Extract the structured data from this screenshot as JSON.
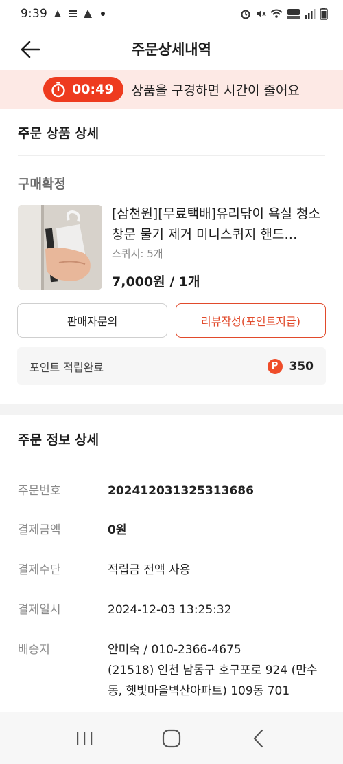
{
  "status_bar": {
    "time": "9:39"
  },
  "header": {
    "title": "주문상세내역"
  },
  "banner": {
    "timer": "00:49",
    "message": "상품을 구경하면 시간이 줄어요"
  },
  "order_items": {
    "section_title": "주문 상품 상세",
    "status": "구매확정",
    "product": {
      "name": "[삼천원][무료택배]유리닦이 욕실 청소 창문 물기 제거 미니스퀴지 핸드…",
      "option": "스퀴지: 5개",
      "price": "7,000원 / 1개"
    },
    "buttons": {
      "seller_inquiry": "판매자문의",
      "write_review": "리뷰작성(포인트지급)"
    },
    "points": {
      "label": "포인트 적립완료",
      "icon": "P",
      "value": "350"
    }
  },
  "order_info": {
    "section_title": "주문 정보 상세",
    "rows": [
      {
        "key": "주문번호",
        "value": "20241203132531368​6"
      },
      {
        "key": "결제금액",
        "value": "0원"
      },
      {
        "key": "결제수단",
        "value": "적립금 전액 사용"
      },
      {
        "key": "결제일시",
        "value": "2024-12-03 13:25:32"
      },
      {
        "key": "배송지",
        "value": "안미숙 / 010-2366-4675",
        "value2": "(21518) 인천 남동구 호구포로 924 (만수동, 햇빛마을벽산아파트) 109동 701"
      }
    ]
  },
  "colors": {
    "accent": "#ee3b1f",
    "banner_bg": "#fde9e5",
    "review_border": "#e14a2b"
  }
}
